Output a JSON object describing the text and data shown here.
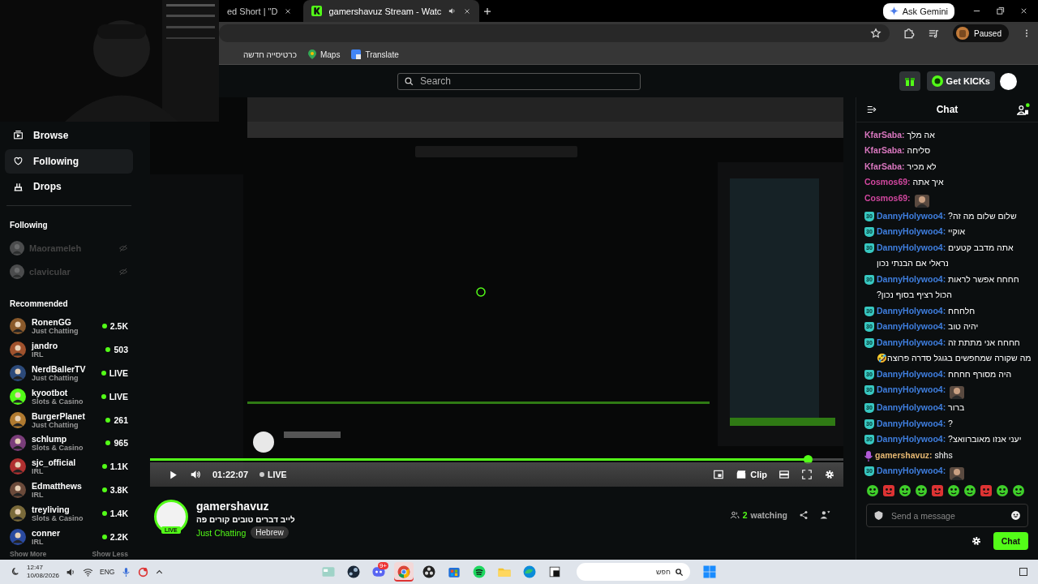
{
  "browser": {
    "tabs": [
      {
        "title": "ed Short | \"D",
        "selected": false,
        "audio": false
      },
      {
        "title": "gamershavuz Stream - Watc",
        "selected": true,
        "audio": true
      }
    ],
    "ask_gemini": "Ask Gemini",
    "profile": "Paused",
    "bookmarks": [
      {
        "label": "כרטיסייה חדשה",
        "kind": "plain"
      },
      {
        "label": "Maps",
        "kind": "maps"
      },
      {
        "label": "Translate",
        "kind": "translate"
      }
    ]
  },
  "header": {
    "search": {
      "placeholder": "Search"
    },
    "get_kicks": "Get KICKs"
  },
  "sidebar": {
    "nav": [
      {
        "label": "Browse",
        "kind": "browse",
        "hovered": false
      },
      {
        "label": "Following",
        "kind": "following",
        "hovered": true
      },
      {
        "label": "Drops",
        "kind": "drops",
        "hovered": false
      }
    ],
    "following_title": "Following",
    "following": [
      {
        "name": "Maorameleh",
        "live": false
      },
      {
        "name": "clavicular",
        "live": false
      }
    ],
    "recommended_title": "Recommended",
    "recommended": [
      {
        "name": "RonenGG",
        "category": "Just Chatting",
        "viewers": "2.5K"
      },
      {
        "name": "jandro",
        "category": "IRL",
        "viewers": "503"
      },
      {
        "name": "NerdBallerTV",
        "category": "Just Chatting",
        "viewers": "LIVE"
      },
      {
        "name": "kyootbot",
        "category": "Slots & Casino",
        "viewers": "LIVE"
      },
      {
        "name": "BurgerPlanet",
        "category": "Just Chatting",
        "viewers": "261"
      },
      {
        "name": "schlump",
        "category": "Slots & Casino",
        "viewers": "965"
      },
      {
        "name": "sjc_official",
        "category": "IRL",
        "viewers": "1.1K"
      },
      {
        "name": "Edmatthews",
        "category": "IRL",
        "viewers": "3.8K"
      },
      {
        "name": "treyliving",
        "category": "Slots & Casino",
        "viewers": "1.4K"
      },
      {
        "name": "conner",
        "category": "IRL",
        "viewers": "2.2K"
      }
    ],
    "show_more": "Show More",
    "show_less": "Show Less"
  },
  "player": {
    "time": "01:22:07",
    "live": "LIVE",
    "clip": "Clip",
    "progress": {
      "level": 0.95
    }
  },
  "channel": {
    "name": "gamershavuz",
    "badge": "LIVE",
    "title": "לייב דברים טובים קורים פה",
    "category": "Just Chatting",
    "tags": [
      "Hebrew"
    ],
    "watching_count": "2",
    "watching_label": "watching"
  },
  "chat": {
    "title": "Chat",
    "messages": [
      {
        "kind": "text",
        "user": "KfarSaba:",
        "color": "#d977bf",
        "text": "אה מלך"
      },
      {
        "kind": "text",
        "user": "KfarSaba:",
        "color": "#d977bf",
        "text": "סליחה"
      },
      {
        "kind": "text",
        "user": "KfarSaba:",
        "color": "#d977bf",
        "text": "לא מכיר"
      },
      {
        "kind": "text",
        "user": "Cosmos69:",
        "color": "#d2479f",
        "text": "איך אתה"
      },
      {
        "kind": "emote",
        "user": "Cosmos69:",
        "color": "#d2479f"
      },
      {
        "kind": "text",
        "user": "DannyHolywoo4:",
        "color": "#3f7fe0",
        "badge": {
          "kind": "sub",
          "label": "30"
        },
        "text": "שלום שלום מה זה?"
      },
      {
        "kind": "text",
        "user": "DannyHolywoo4:",
        "color": "#3f7fe0",
        "badge": {
          "kind": "sub",
          "label": "30"
        },
        "text": "אוקיי"
      },
      {
        "kind": "text",
        "user": "DannyHolywoo4:",
        "color": "#3f7fe0",
        "badge": {
          "kind": "sub",
          "label": "30"
        },
        "text": "אתה מדבב קטעים נראלי אם הבנתי נכון"
      },
      {
        "kind": "text",
        "user": "DannyHolywoo4:",
        "color": "#3f7fe0",
        "badge": {
          "kind": "sub",
          "label": "30"
        },
        "text": "חחחח אפשר לראות הכול רציף בסוף נכון?"
      },
      {
        "kind": "text",
        "user": "DannyHolywoo4:",
        "color": "#3f7fe0",
        "badge": {
          "kind": "sub",
          "label": "30"
        },
        "text": "חלחחח"
      },
      {
        "kind": "text",
        "user": "DannyHolywoo4:",
        "color": "#3f7fe0",
        "badge": {
          "kind": "sub",
          "label": "30"
        },
        "text": "יהיה טוב"
      },
      {
        "kind": "text",
        "user": "DannyHolywoo4:",
        "color": "#3f7fe0",
        "badge": {
          "kind": "sub",
          "label": "30"
        },
        "text": "חחחח אני מתתת זה מה שקורה שמחפשים בגוגל סדרה פרוצה🤣"
      },
      {
        "kind": "text",
        "user": "DannyHolywoo4:",
        "color": "#3f7fe0",
        "badge": {
          "kind": "sub",
          "label": "30"
        },
        "text": "היה מסורף חחחח"
      },
      {
        "kind": "emote",
        "user": "DannyHolywoo4:",
        "color": "#3f7fe0",
        "badge": {
          "kind": "sub",
          "label": "30"
        }
      },
      {
        "kind": "text",
        "user": "DannyHolywoo4:",
        "color": "#3f7fe0",
        "badge": {
          "kind": "sub",
          "label": "30"
        },
        "text": "ברור"
      },
      {
        "kind": "text",
        "user": "DannyHolywoo4:",
        "color": "#3f7fe0",
        "badge": {
          "kind": "sub",
          "label": "30"
        },
        "text": "?"
      },
      {
        "kind": "text",
        "user": "DannyHolywoo4:",
        "color": "#3f7fe0",
        "badge": {
          "kind": "sub",
          "label": "30"
        },
        "text": "יעני אנזו מאוברוואצ?"
      },
      {
        "kind": "text",
        "user": "gamershavuz:",
        "color": "#e6b872",
        "badge": {
          "kind": "mic"
        },
        "text": "shhs"
      },
      {
        "kind": "emote",
        "user": "DannyHolywoo4:",
        "color": "#3f7fe0",
        "badge": {
          "kind": "sub",
          "label": "30"
        }
      }
    ],
    "input": {
      "placeholder": "Send a message"
    },
    "send": "Chat"
  },
  "taskbar": {
    "time": "12:47",
    "date": "10/08/2026",
    "language": "ENG",
    "search": {
      "placeholder": "חפש"
    },
    "apps": [
      {
        "kind": "widgets",
        "selected": false
      },
      {
        "kind": "steam",
        "selected": false
      },
      {
        "kind": "discord",
        "selected": false,
        "badge": "9+"
      },
      {
        "kind": "chrome",
        "selected": true
      },
      {
        "kind": "obs",
        "selected": false
      },
      {
        "kind": "store",
        "selected": false
      },
      {
        "kind": "spotify",
        "selected": false
      },
      {
        "kind": "files",
        "selected": false
      },
      {
        "kind": "edge",
        "selected": false
      },
      {
        "kind": "terminal",
        "selected": false
      }
    ]
  }
}
